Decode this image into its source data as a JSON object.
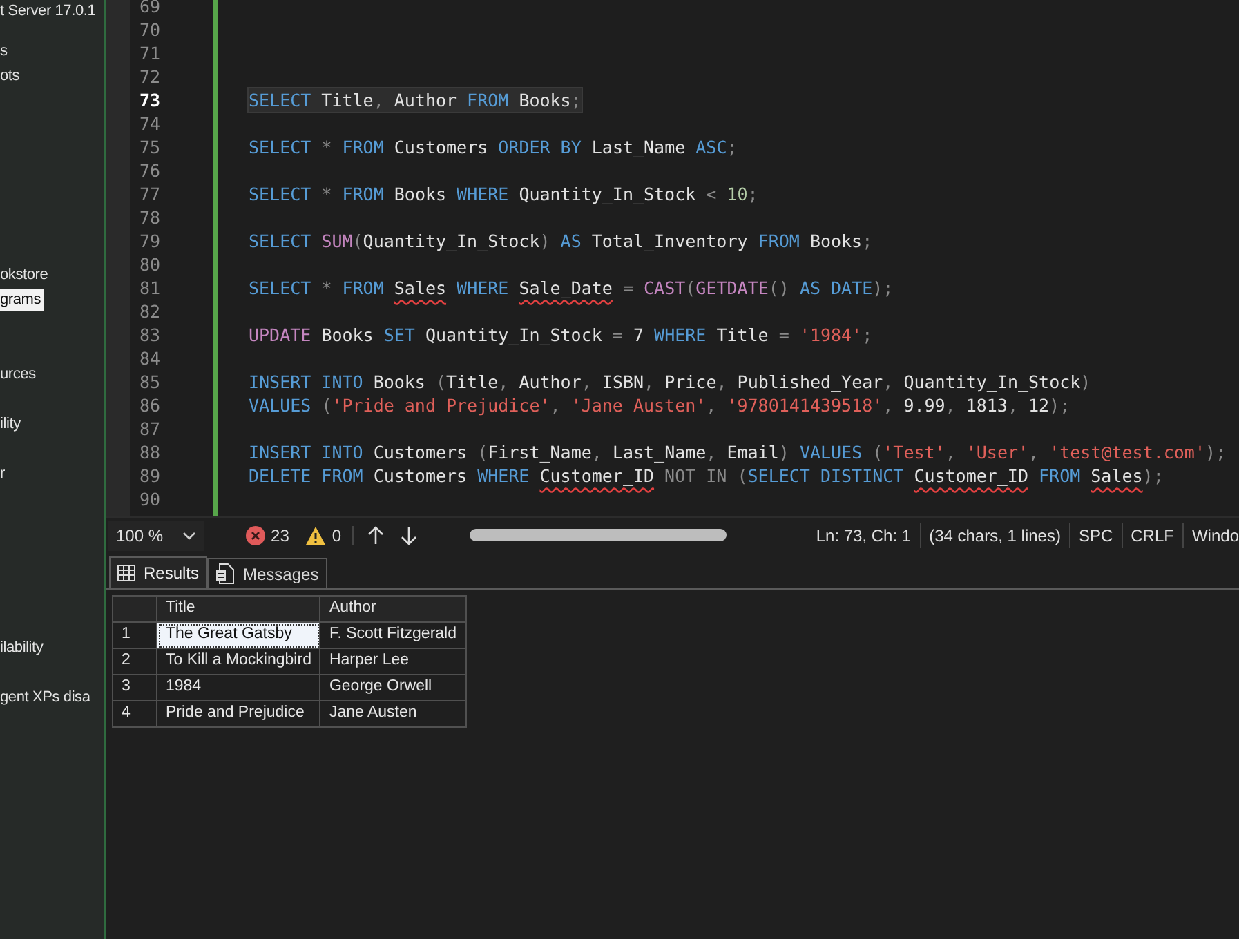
{
  "explorer": {
    "items": [
      {
        "label": "t Server 17.0.1",
        "selected": false
      },
      {
        "label": "s",
        "selected": false
      },
      {
        "label": "ots",
        "selected": false
      },
      {
        "label": "okstore",
        "selected": false
      },
      {
        "label": "grams",
        "selected": true
      },
      {
        "label": "urces",
        "selected": false
      },
      {
        "label": "ility",
        "selected": false
      },
      {
        "label": "r",
        "selected": false
      },
      {
        "label": "ilability",
        "selected": false
      },
      {
        "label": "gent XPs disa",
        "selected": false
      }
    ]
  },
  "editor": {
    "lines": [
      {
        "number": "69",
        "current": false
      },
      {
        "number": "70",
        "current": false
      },
      {
        "number": "71",
        "current": false
      },
      {
        "number": "72",
        "current": false
      },
      {
        "number": "73",
        "current": true,
        "tokens": [
          {
            "t": "SELECT",
            "kind": "kw"
          },
          {
            "t": " Title",
            "kind": "id"
          },
          {
            "t": ", ",
            "kind": "op"
          },
          {
            "t": "Author",
            "kind": "id"
          },
          {
            "t": " FROM ",
            "kind": "kw"
          },
          {
            "t": "Books",
            "kind": "id"
          },
          {
            "t": ";",
            "kind": "op"
          }
        ]
      },
      {
        "number": "74",
        "current": false
      },
      {
        "number": "75",
        "current": false,
        "tokens": [
          {
            "t": "SELECT ",
            "kind": "kw"
          },
          {
            "t": "* ",
            "kind": "op"
          },
          {
            "t": "FROM ",
            "kind": "kw"
          },
          {
            "t": "Customers ",
            "kind": "id"
          },
          {
            "t": "ORDER BY ",
            "kind": "kw"
          },
          {
            "t": "Last_Name ",
            "kind": "id"
          },
          {
            "t": "ASC",
            "kind": "kw"
          },
          {
            "t": ";",
            "kind": "op"
          }
        ]
      },
      {
        "number": "76",
        "current": false
      },
      {
        "number": "77",
        "current": false,
        "tokens": [
          {
            "t": "SELECT ",
            "kind": "kw"
          },
          {
            "t": "* ",
            "kind": "op"
          },
          {
            "t": "FROM ",
            "kind": "kw"
          },
          {
            "t": "Books ",
            "kind": "id"
          },
          {
            "t": "WHERE ",
            "kind": "kw"
          },
          {
            "t": "Quantity_In_Stock ",
            "kind": "id"
          },
          {
            "t": "< ",
            "kind": "op"
          },
          {
            "t": "10",
            "kind": "num"
          },
          {
            "t": ";",
            "kind": "op"
          }
        ]
      },
      {
        "number": "78",
        "current": false
      },
      {
        "number": "79",
        "current": false,
        "tokens": [
          {
            "t": "SELECT ",
            "kind": "kw"
          },
          {
            "t": "SUM",
            "kind": "fn"
          },
          {
            "t": "(",
            "kind": "op"
          },
          {
            "t": "Quantity_In_Stock",
            "kind": "id"
          },
          {
            "t": ") ",
            "kind": "op"
          },
          {
            "t": "AS ",
            "kind": "kw"
          },
          {
            "t": "Total_Inventory ",
            "kind": "id"
          },
          {
            "t": "FROM ",
            "kind": "kw"
          },
          {
            "t": "Books",
            "kind": "id"
          },
          {
            "t": ";",
            "kind": "op"
          }
        ]
      },
      {
        "number": "80",
        "current": false
      },
      {
        "number": "81",
        "current": false,
        "tokens": [
          {
            "t": "SELECT ",
            "kind": "kw"
          },
          {
            "t": "* ",
            "kind": "op"
          },
          {
            "t": "FROM ",
            "kind": "kw"
          },
          {
            "t": "Sales",
            "kind": "err"
          },
          {
            "t": " WHERE ",
            "kind": "kw"
          },
          {
            "t": "Sale_Date",
            "kind": "err"
          },
          {
            "t": " = ",
            "kind": "op"
          },
          {
            "t": "CAST",
            "kind": "fn"
          },
          {
            "t": "(",
            "kind": "op"
          },
          {
            "t": "GETDATE",
            "kind": "fn"
          },
          {
            "t": "() ",
            "kind": "op"
          },
          {
            "t": "AS DATE",
            "kind": "kw"
          },
          {
            "t": ");",
            "kind": "op"
          }
        ]
      },
      {
        "number": "82",
        "current": false
      },
      {
        "number": "83",
        "current": false,
        "tokens": [
          {
            "t": "UPDATE ",
            "kind": "fn"
          },
          {
            "t": "Books ",
            "kind": "id"
          },
          {
            "t": "SET ",
            "kind": "kw"
          },
          {
            "t": "Quantity_In_Stock ",
            "kind": "id"
          },
          {
            "t": "= ",
            "kind": "op"
          },
          {
            "t": "7 ",
            "kind": "id"
          },
          {
            "t": "WHERE ",
            "kind": "kw"
          },
          {
            "t": "Title ",
            "kind": "id"
          },
          {
            "t": "= ",
            "kind": "op"
          },
          {
            "t": "'1984'",
            "kind": "str"
          },
          {
            "t": ";",
            "kind": "op"
          }
        ]
      },
      {
        "number": "84",
        "current": false
      },
      {
        "number": "85",
        "current": false,
        "tokens": [
          {
            "t": "INSERT INTO ",
            "kind": "kw"
          },
          {
            "t": "Books ",
            "kind": "id"
          },
          {
            "t": "(",
            "kind": "op"
          },
          {
            "t": "Title",
            "kind": "id"
          },
          {
            "t": ", ",
            "kind": "op"
          },
          {
            "t": "Author",
            "kind": "id"
          },
          {
            "t": ", ",
            "kind": "op"
          },
          {
            "t": "ISBN",
            "kind": "id"
          },
          {
            "t": ", ",
            "kind": "op"
          },
          {
            "t": "Price",
            "kind": "id"
          },
          {
            "t": ", ",
            "kind": "op"
          },
          {
            "t": "Published_Year",
            "kind": "id"
          },
          {
            "t": ", ",
            "kind": "op"
          },
          {
            "t": "Quantity_In_Stock",
            "kind": "id"
          },
          {
            "t": ")",
            "kind": "op"
          }
        ]
      },
      {
        "number": "86",
        "current": false,
        "tokens": [
          {
            "t": "VALUES ",
            "kind": "kw"
          },
          {
            "t": "(",
            "kind": "op"
          },
          {
            "t": "'Pride and Prejudice'",
            "kind": "str"
          },
          {
            "t": ", ",
            "kind": "op"
          },
          {
            "t": "'Jane Austen'",
            "kind": "str"
          },
          {
            "t": ", ",
            "kind": "op"
          },
          {
            "t": "'9780141439518'",
            "kind": "str"
          },
          {
            "t": ", ",
            "kind": "op"
          },
          {
            "t": "9.99",
            "kind": "id"
          },
          {
            "t": ", ",
            "kind": "op"
          },
          {
            "t": "1813",
            "kind": "id"
          },
          {
            "t": ", ",
            "kind": "op"
          },
          {
            "t": "12",
            "kind": "id"
          },
          {
            "t": ");",
            "kind": "op"
          }
        ]
      },
      {
        "number": "87",
        "current": false
      },
      {
        "number": "88",
        "current": false,
        "tokens": [
          {
            "t": "INSERT INTO ",
            "kind": "kw"
          },
          {
            "t": "Customers ",
            "kind": "id"
          },
          {
            "t": "(",
            "kind": "op"
          },
          {
            "t": "First_Name",
            "kind": "id"
          },
          {
            "t": ", ",
            "kind": "op"
          },
          {
            "t": "Last_Name",
            "kind": "id"
          },
          {
            "t": ", ",
            "kind": "op"
          },
          {
            "t": "Email",
            "kind": "id"
          },
          {
            "t": ") ",
            "kind": "op"
          },
          {
            "t": "VALUES ",
            "kind": "kw"
          },
          {
            "t": "(",
            "kind": "op"
          },
          {
            "t": "'Test'",
            "kind": "str"
          },
          {
            "t": ", ",
            "kind": "op"
          },
          {
            "t": "'User'",
            "kind": "str"
          },
          {
            "t": ", ",
            "kind": "op"
          },
          {
            "t": "'test@test.com'",
            "kind": "str"
          },
          {
            "t": ");",
            "kind": "op"
          }
        ]
      },
      {
        "number": "89",
        "current": false,
        "tokens": [
          {
            "t": "DELETE FROM ",
            "kind": "kw"
          },
          {
            "t": "Customers ",
            "kind": "id"
          },
          {
            "t": "WHERE ",
            "kind": "kw"
          },
          {
            "t": "Customer_ID",
            "kind": "err"
          },
          {
            "t": " NOT IN ",
            "kind": "op"
          },
          {
            "t": "(",
            "kind": "op"
          },
          {
            "t": "SELECT DISTINCT ",
            "kind": "kw"
          },
          {
            "t": "Customer_ID",
            "kind": "err"
          },
          {
            "t": " FROM ",
            "kind": "kw"
          },
          {
            "t": "Sales",
            "kind": "err"
          },
          {
            "t": ");",
            "kind": "op"
          }
        ]
      },
      {
        "number": "90",
        "current": false
      }
    ]
  },
  "status_bar": {
    "zoom": "100 %",
    "errors": "23",
    "warnings": "0",
    "position": "Ln: 73, Ch: 1",
    "selection": "(34 chars, 1 lines)",
    "indent": "SPC",
    "line_ending": "CRLF",
    "encoding": "Windo"
  },
  "results": {
    "tabs": [
      {
        "label": "Results",
        "selected": true
      },
      {
        "label": "Messages",
        "selected": false
      }
    ],
    "columns": [
      "Title",
      "Author"
    ],
    "rows": [
      {
        "number": "1",
        "cells": [
          "The Great Gatsby",
          "F. Scott Fitzgerald"
        ],
        "selected": true
      },
      {
        "number": "2",
        "cells": [
          "To Kill a Mockingbird",
          "Harper Lee"
        ],
        "selected": false
      },
      {
        "number": "3",
        "cells": [
          "1984",
          "George Orwell"
        ],
        "selected": false
      },
      {
        "number": "4",
        "cells": [
          "Pride and Prejudice",
          "Jane Austen"
        ],
        "selected": false
      }
    ]
  }
}
